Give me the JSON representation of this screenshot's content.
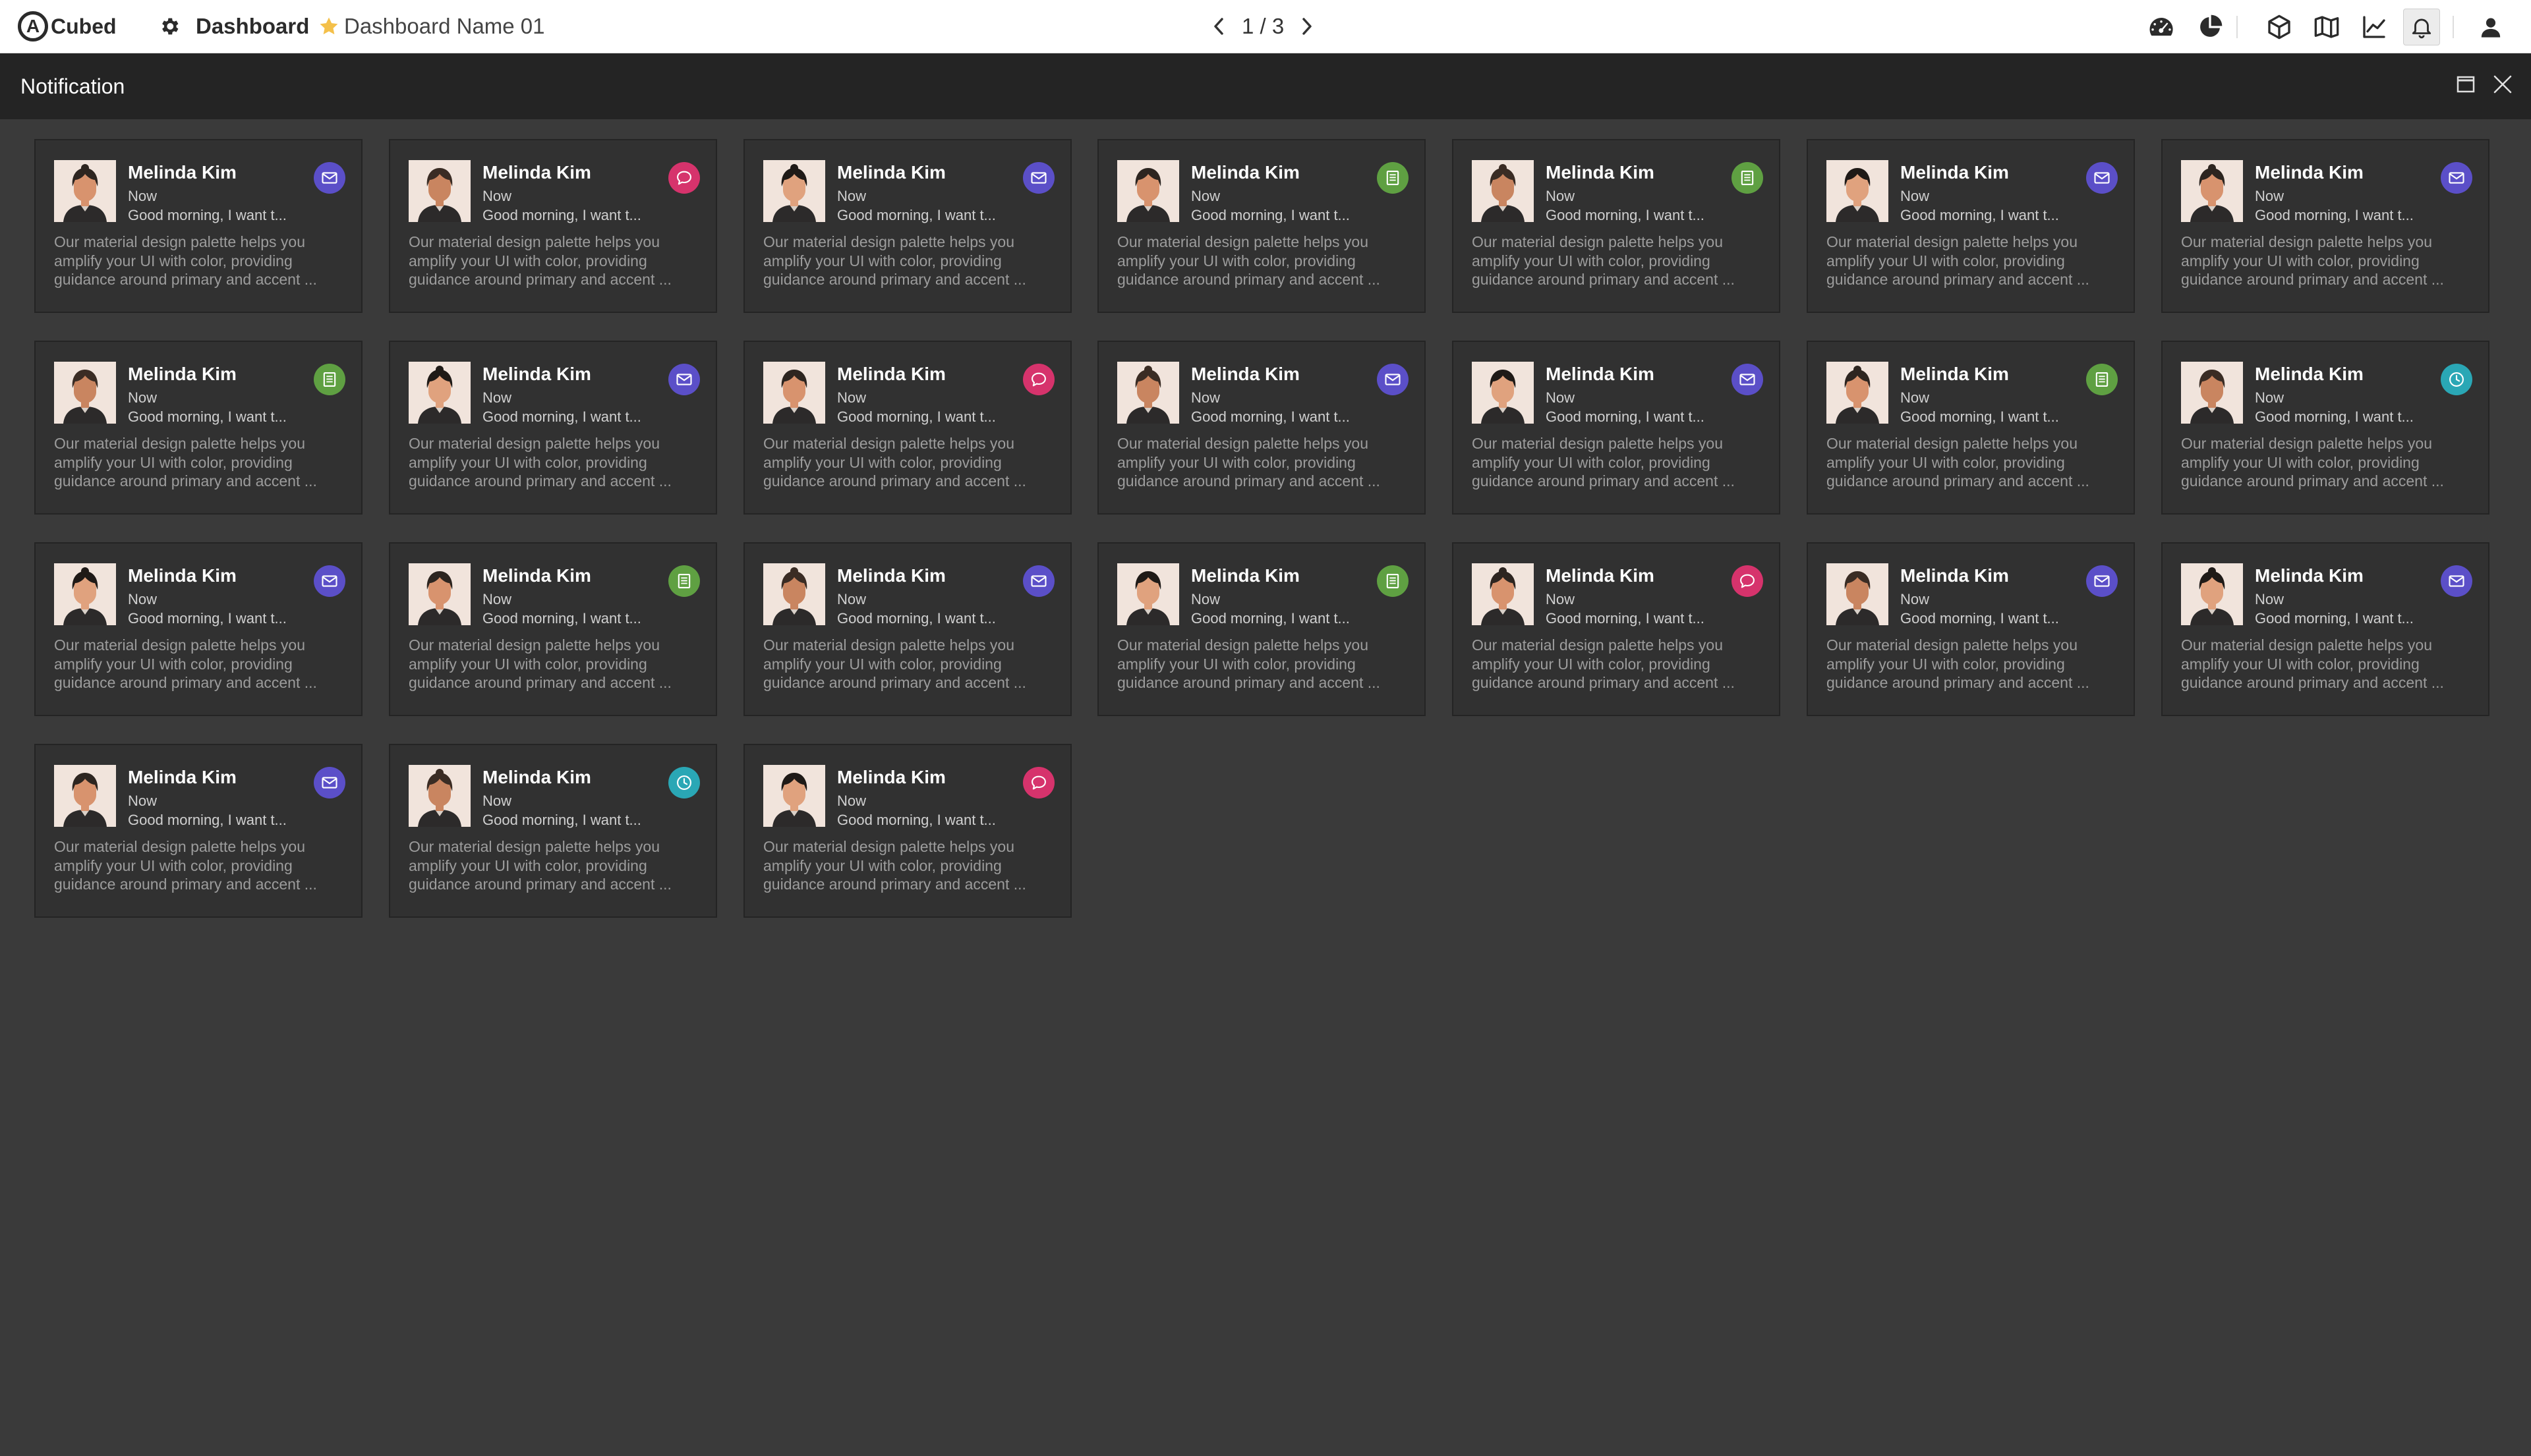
{
  "app": {
    "logo_letter": "A",
    "logo_text": "Cubed"
  },
  "header": {
    "dashboard_label": "Dashboard",
    "dashboard_name": "Dashboard Name 01",
    "pager": "1 / 3"
  },
  "toolbar": {
    "icons": [
      "dashboard-gauge-icon",
      "pie-chart-icon",
      "cube-icon",
      "map-icon",
      "line-chart-icon",
      "bell-icon",
      "user-icon"
    ],
    "active": "bell-icon"
  },
  "panel": {
    "title": "Notification"
  },
  "colors": {
    "mail": "#5b4fc8",
    "chat": "#d6336c",
    "note": "#5fa042",
    "clock": "#2aa7b5",
    "star": "#f4c04a"
  },
  "cards": [
    {
      "name": "Melinda Kim",
      "time": "Now",
      "preview": "Good morning, I want t...",
      "body": "Our material design palette helps you amplify your UI with color, providing guidance around primary and accent ...",
      "badge": "mail"
    },
    {
      "name": "Melinda Kim",
      "time": "Now",
      "preview": "Good morning, I want t...",
      "body": "Our material design palette helps you amplify your UI with color, providing guidance around primary and accent ...",
      "badge": "chat"
    },
    {
      "name": "Melinda Kim",
      "time": "Now",
      "preview": "Good morning, I want t...",
      "body": "Our material design palette helps you amplify your UI with color, providing guidance around primary and accent ...",
      "badge": "mail"
    },
    {
      "name": "Melinda Kim",
      "time": "Now",
      "preview": "Good morning, I want t...",
      "body": "Our material design palette helps you amplify your UI with color, providing guidance around primary and accent ...",
      "badge": "note"
    },
    {
      "name": "Melinda Kim",
      "time": "Now",
      "preview": "Good morning, I want t...",
      "body": "Our material design palette helps you amplify your UI with color, providing guidance around primary and accent ...",
      "badge": "note"
    },
    {
      "name": "Melinda Kim",
      "time": "Now",
      "preview": "Good morning, I want t...",
      "body": "Our material design palette helps you amplify your UI with color, providing guidance around primary and accent ...",
      "badge": "mail"
    },
    {
      "name": "Melinda Kim",
      "time": "Now",
      "preview": "Good morning, I want t...",
      "body": "Our material design palette helps you amplify your UI with color, providing guidance around primary and accent ...",
      "badge": "mail"
    },
    {
      "name": "Melinda Kim",
      "time": "Now",
      "preview": "Good morning, I want t...",
      "body": "Our material design palette helps you amplify your UI with color, providing guidance around primary and accent ...",
      "badge": "note"
    },
    {
      "name": "Melinda Kim",
      "time": "Now",
      "preview": "Good morning, I want t...",
      "body": "Our material design palette helps you amplify your UI with color, providing guidance around primary and accent ...",
      "badge": "mail"
    },
    {
      "name": "Melinda Kim",
      "time": "Now",
      "preview": "Good morning, I want t...",
      "body": "Our material design palette helps you amplify your UI with color, providing guidance around primary and accent ...",
      "badge": "chat"
    },
    {
      "name": "Melinda Kim",
      "time": "Now",
      "preview": "Good morning, I want t...",
      "body": "Our material design palette helps you amplify your UI with color, providing guidance around primary and accent ...",
      "badge": "mail"
    },
    {
      "name": "Melinda Kim",
      "time": "Now",
      "preview": "Good morning, I want t...",
      "body": "Our material design palette helps you amplify your UI with color, providing guidance around primary and accent ...",
      "badge": "mail"
    },
    {
      "name": "Melinda Kim",
      "time": "Now",
      "preview": "Good morning, I want t...",
      "body": "Our material design palette helps you amplify your UI with color, providing guidance around primary and accent ...",
      "badge": "note"
    },
    {
      "name": "Melinda Kim",
      "time": "Now",
      "preview": "Good morning, I want t...",
      "body": "Our material design palette helps you amplify your UI with color, providing guidance around primary and accent ...",
      "badge": "clock"
    },
    {
      "name": "Melinda Kim",
      "time": "Now",
      "preview": "Good morning, I want t...",
      "body": "Our material design palette helps you amplify your UI with color, providing guidance around primary and accent ...",
      "badge": "mail"
    },
    {
      "name": "Melinda Kim",
      "time": "Now",
      "preview": "Good morning, I want t...",
      "body": "Our material design palette helps you amplify your UI with color, providing guidance around primary and accent ...",
      "badge": "note"
    },
    {
      "name": "Melinda Kim",
      "time": "Now",
      "preview": "Good morning, I want t...",
      "body": "Our material design palette helps you amplify your UI with color, providing guidance around primary and accent ...",
      "badge": "mail"
    },
    {
      "name": "Melinda Kim",
      "time": "Now",
      "preview": "Good morning, I want t...",
      "body": "Our material design palette helps you amplify your UI with color, providing guidance around primary and accent ...",
      "badge": "note"
    },
    {
      "name": "Melinda Kim",
      "time": "Now",
      "preview": "Good morning, I want t...",
      "body": "Our material design palette helps you amplify your UI with color, providing guidance around primary and accent ...",
      "badge": "chat"
    },
    {
      "name": "Melinda Kim",
      "time": "Now",
      "preview": "Good morning, I want t...",
      "body": "Our material design palette helps you amplify your UI with color, providing guidance around primary and accent ...",
      "badge": "mail"
    },
    {
      "name": "Melinda Kim",
      "time": "Now",
      "preview": "Good morning, I want t...",
      "body": "Our material design palette helps you amplify your UI with color, providing guidance around primary and accent ...",
      "badge": "mail"
    },
    {
      "name": "Melinda Kim",
      "time": "Now",
      "preview": "Good morning, I want t...",
      "body": "Our material design palette helps you amplify your UI with color, providing guidance around primary and accent ...",
      "badge": "mail"
    },
    {
      "name": "Melinda Kim",
      "time": "Now",
      "preview": "Good morning, I want t...",
      "body": "Our material design palette helps you amplify your UI with color, providing guidance around primary and accent ...",
      "badge": "clock"
    },
    {
      "name": "Melinda Kim",
      "time": "Now",
      "preview": "Good morning, I want t...",
      "body": "Our material design palette helps you amplify your UI with color, providing guidance around primary and accent ...",
      "badge": "chat"
    }
  ]
}
